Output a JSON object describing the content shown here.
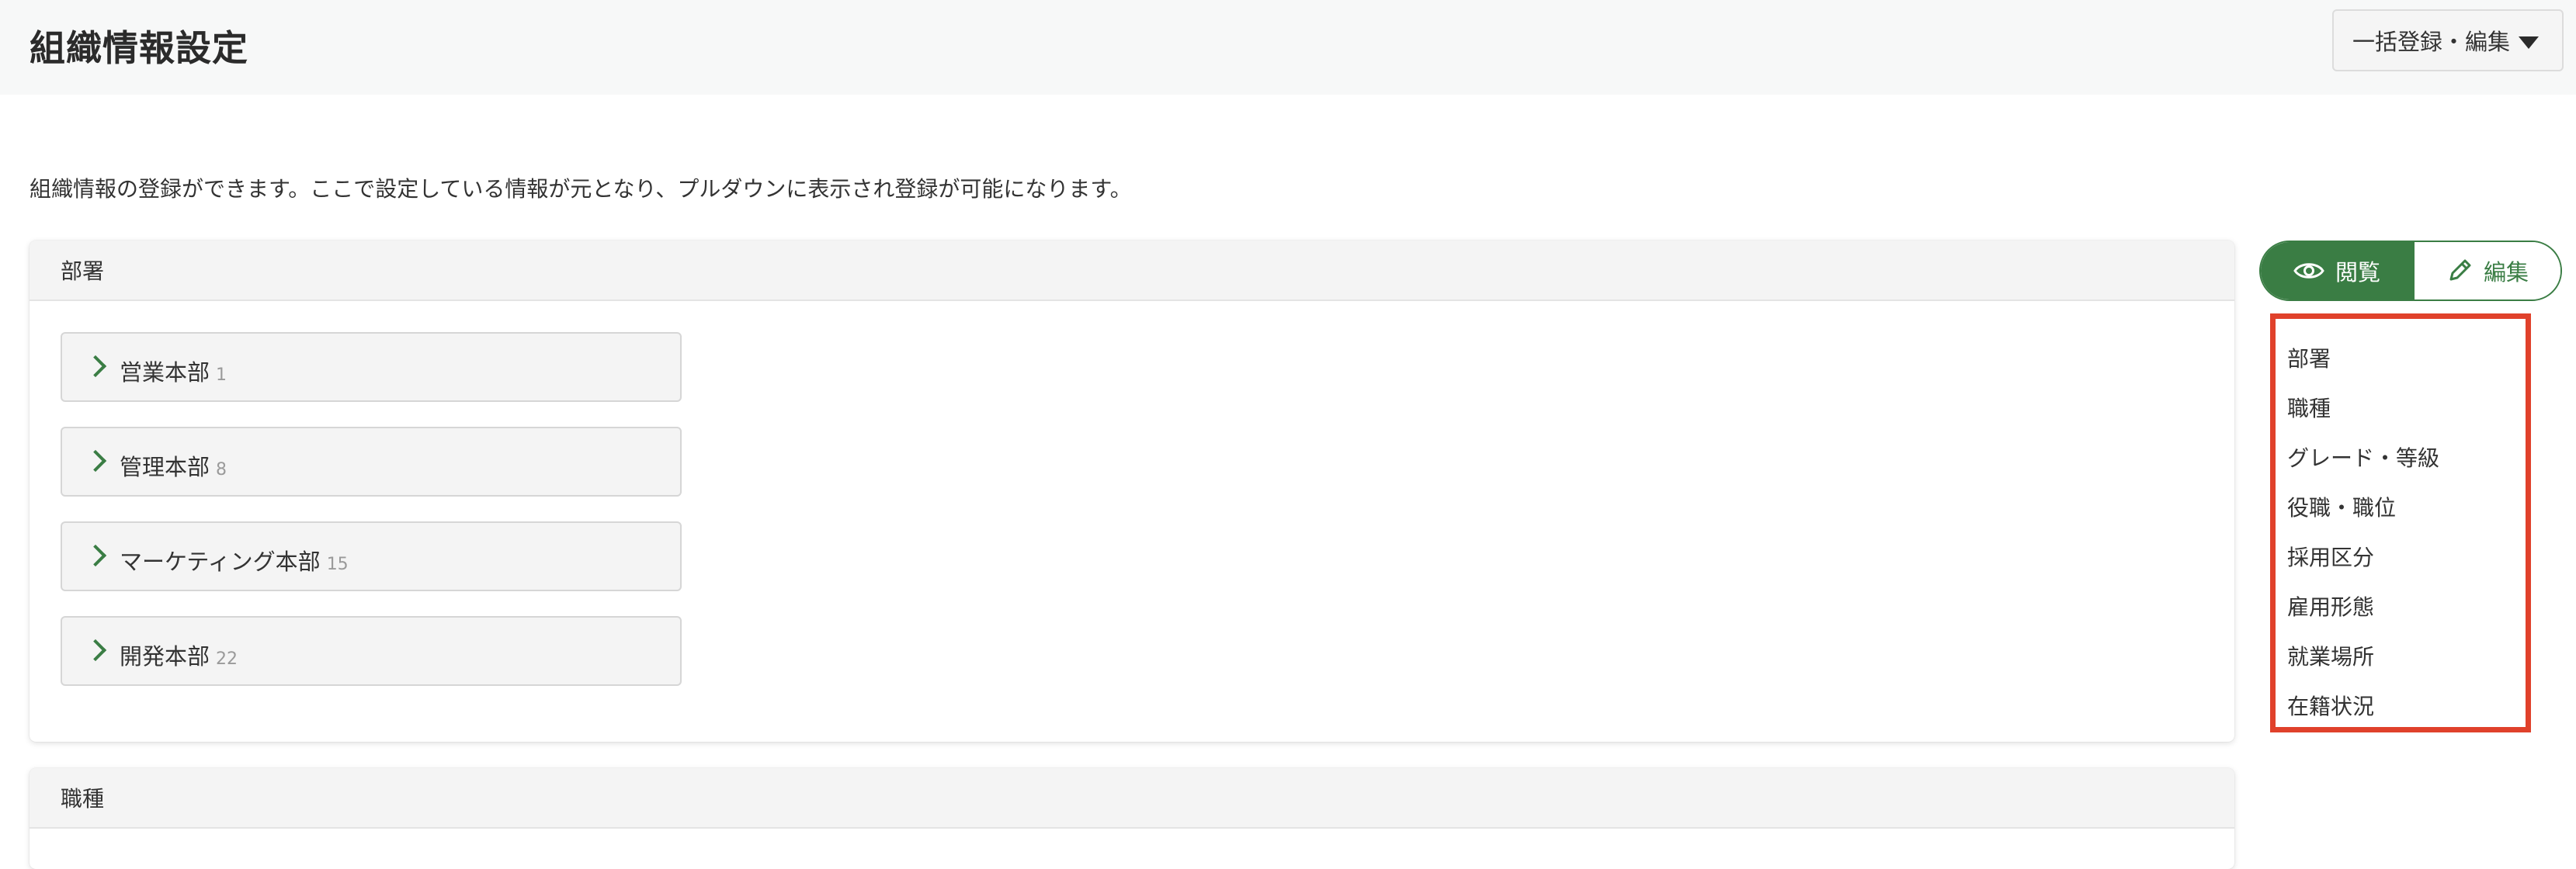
{
  "header": {
    "title": "組織情報設定",
    "bulk_button_label": "一括登録・編集",
    "bulk_button_icon": "caret-down-icon"
  },
  "description": "組織情報の登録ができます。ここで設定している情報が元となり、プルダウンに表示され登録が可能になります。",
  "sections": [
    {
      "title": "部署",
      "items": [
        {
          "name": "営業本部",
          "count": "1"
        },
        {
          "name": "管理本部",
          "count": "8"
        },
        {
          "name": "マーケティング本部",
          "count": "15"
        },
        {
          "name": "開発本部",
          "count": "22"
        }
      ]
    },
    {
      "title": "職種",
      "items": []
    }
  ],
  "view_toggle": {
    "view_label": "閲覧",
    "view_icon": "eye-icon",
    "edit_label": "編集",
    "edit_icon": "pencil-icon",
    "active": "view"
  },
  "side_nav": {
    "items": [
      "部署",
      "職種",
      "グレード・等級",
      "役職・職位",
      "採用区分",
      "雇用形態",
      "就業場所",
      "在籍状況"
    ]
  },
  "colors": {
    "accent": "#3a7d44",
    "highlight_border": "#e0412b",
    "header_bg": "#f7f8f8"
  }
}
